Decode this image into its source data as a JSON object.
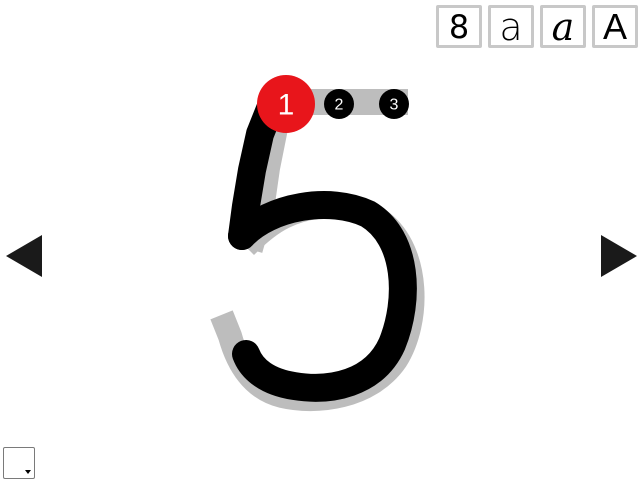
{
  "modes": [
    {
      "id": "digit",
      "label": "8"
    },
    {
      "id": "print",
      "label": "a"
    },
    {
      "id": "cursive",
      "label": "a"
    },
    {
      "id": "upper",
      "label": "A"
    }
  ],
  "current_character": "5",
  "stroke_steps": [
    {
      "label": "1",
      "active": true
    },
    {
      "label": "2",
      "active": false
    },
    {
      "label": "3",
      "active": false
    }
  ],
  "colors": {
    "ink": "#000000",
    "guide": "#bdbdbd",
    "active_step": "#e8151b",
    "step": "#000000",
    "button_border": "#c8c8c8",
    "arrow": "#1a1a1a"
  },
  "icons": {
    "prev": "triangle-left-icon",
    "next": "triangle-right-icon",
    "color_picker": "color-swatch-dropdown-icon"
  }
}
